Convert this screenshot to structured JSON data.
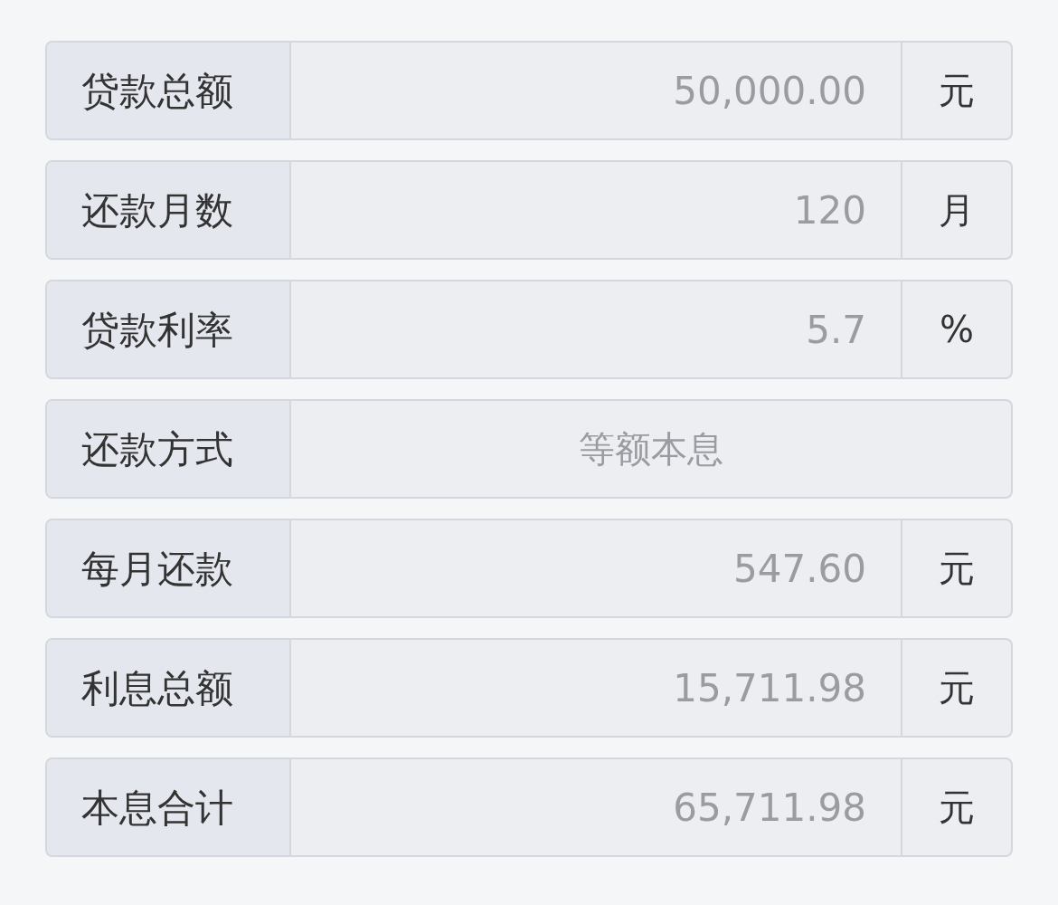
{
  "rows": [
    {
      "kind": "field",
      "label": "贷款总额",
      "value": "50,000.00",
      "unit": "元"
    },
    {
      "kind": "field",
      "label": "还款月数",
      "value": "120",
      "unit": "月"
    },
    {
      "kind": "field",
      "label": "贷款利率",
      "value": "5.7",
      "unit": "%"
    },
    {
      "kind": "choice",
      "label": "还款方式",
      "value": "等额本息"
    },
    {
      "kind": "field",
      "label": "每月还款",
      "value": "547.60",
      "unit": "元"
    },
    {
      "kind": "field",
      "label": "利息总额",
      "value": "15,711.98",
      "unit": "元"
    },
    {
      "kind": "field",
      "label": "本息合计",
      "value": "65,711.98",
      "unit": "元"
    }
  ]
}
